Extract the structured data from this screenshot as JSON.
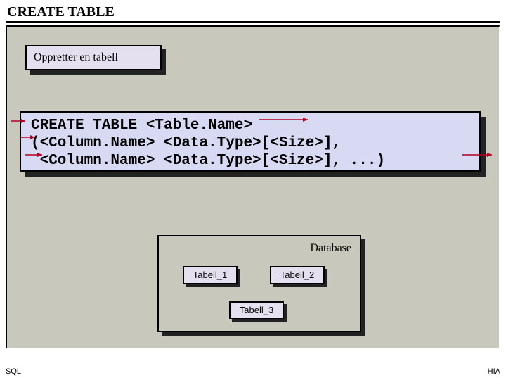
{
  "title": "CREATE TABLE",
  "subtitle": "Oppretter en tabell",
  "code": {
    "line1": "CREATE TABLE <Table.Name>",
    "line2": "(<Column.Name> <Data.Type>[<Size>],",
    "line3": " <Column.Name> <Data.Type>[<Size>], ...)"
  },
  "database": {
    "heading": "Database",
    "tables": {
      "t1": "Tabell_1",
      "t2": "Tabell_2",
      "t3": "Tabell_3"
    }
  },
  "footer": {
    "left": "SQL",
    "right": "HIA"
  }
}
